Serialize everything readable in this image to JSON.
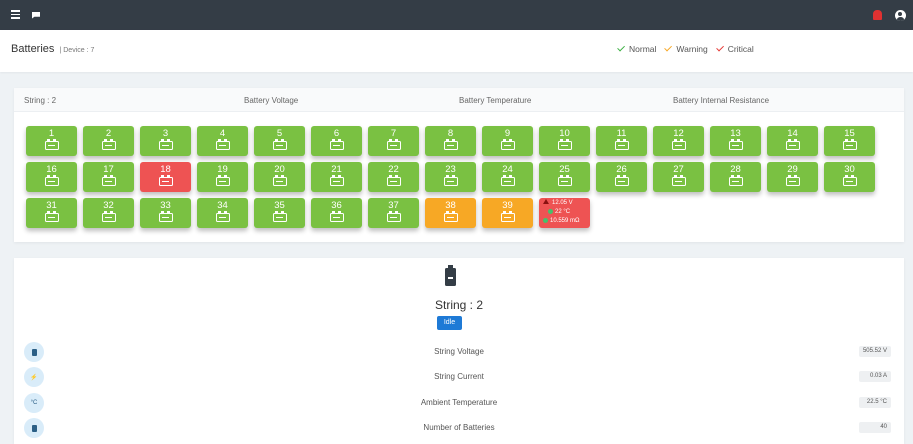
{
  "header": {
    "title": "Batteries",
    "device": "| Device : 7"
  },
  "legend": [
    {
      "label": "Normal",
      "color": "#3cb043"
    },
    {
      "label": "Warning",
      "color": "#f7a825"
    },
    {
      "label": "Critical",
      "color": "#e53935"
    }
  ],
  "columns": {
    "string": "String : 2",
    "voltage": "Battery Voltage",
    "temperature": "Battery Temperature",
    "resistance": "Battery Internal Resistance"
  },
  "batteries": [
    {
      "n": "1",
      "s": "normal"
    },
    {
      "n": "2",
      "s": "normal"
    },
    {
      "n": "3",
      "s": "normal"
    },
    {
      "n": "4",
      "s": "normal"
    },
    {
      "n": "5",
      "s": "normal"
    },
    {
      "n": "6",
      "s": "normal"
    },
    {
      "n": "7",
      "s": "normal"
    },
    {
      "n": "8",
      "s": "normal"
    },
    {
      "n": "9",
      "s": "normal"
    },
    {
      "n": "10",
      "s": "normal"
    },
    {
      "n": "11",
      "s": "normal"
    },
    {
      "n": "12",
      "s": "normal"
    },
    {
      "n": "13",
      "s": "normal"
    },
    {
      "n": "14",
      "s": "normal"
    },
    {
      "n": "15",
      "s": "normal"
    },
    {
      "n": "16",
      "s": "normal"
    },
    {
      "n": "17",
      "s": "normal"
    },
    {
      "n": "18",
      "s": "critical"
    },
    {
      "n": "19",
      "s": "normal"
    },
    {
      "n": "20",
      "s": "normal"
    },
    {
      "n": "21",
      "s": "normal"
    },
    {
      "n": "22",
      "s": "normal"
    },
    {
      "n": "23",
      "s": "normal"
    },
    {
      "n": "24",
      "s": "normal"
    },
    {
      "n": "25",
      "s": "normal"
    },
    {
      "n": "26",
      "s": "normal"
    },
    {
      "n": "27",
      "s": "normal"
    },
    {
      "n": "28",
      "s": "normal"
    },
    {
      "n": "29",
      "s": "normal"
    },
    {
      "n": "30",
      "s": "normal"
    },
    {
      "n": "31",
      "s": "normal"
    },
    {
      "n": "32",
      "s": "normal"
    },
    {
      "n": "33",
      "s": "normal"
    },
    {
      "n": "34",
      "s": "normal"
    },
    {
      "n": "35",
      "s": "normal"
    },
    {
      "n": "36",
      "s": "normal"
    },
    {
      "n": "37",
      "s": "normal"
    },
    {
      "n": "38",
      "s": "warning"
    },
    {
      "n": "39",
      "s": "warning"
    }
  ],
  "selected_battery": {
    "voltage": "12.05 V",
    "temperature": "22 °C",
    "resistance": "10.559 mΩ"
  },
  "string_info": {
    "title": "String : 2",
    "status": "Idle",
    "rows": [
      {
        "label": "String Voltage",
        "value": "505.52 V",
        "icon": "battery-icon"
      },
      {
        "label": "String Current",
        "value": "0.03 A",
        "icon": "current-icon"
      },
      {
        "label": "Ambient Temperature",
        "value": "22.5 °C",
        "icon": "temperature-icon"
      },
      {
        "label": "Number of Batteries",
        "value": "40",
        "icon": "battery-count-icon"
      }
    ]
  },
  "icons": {
    "temp_glyph": "°C",
    "current_glyph": "⚡"
  }
}
